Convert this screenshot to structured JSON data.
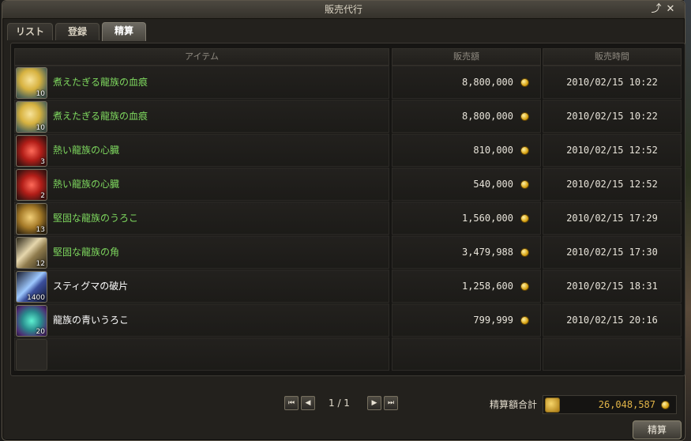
{
  "window": {
    "title": "販売代行"
  },
  "tabs": [
    {
      "label": "リスト"
    },
    {
      "label": "登録"
    },
    {
      "label": "精算"
    }
  ],
  "columns": {
    "item": "アイテム",
    "price": "販売額",
    "time": "販売時間"
  },
  "rows": [
    {
      "name": "煮えたぎる龍族の血痕",
      "count": "10",
      "price": "8,800,000",
      "time": "2010/02/15 10:22",
      "icon": "golden-blood-splatter-icon"
    },
    {
      "name": "煮えたぎる龍族の血痕",
      "count": "10",
      "price": "8,800,000",
      "time": "2010/02/15 10:22",
      "icon": "golden-blood-splatter-icon"
    },
    {
      "name": "熱い龍族の心臓",
      "count": "3",
      "price": "810,000",
      "time": "2010/02/15 12:52",
      "icon": "red-heart-icon"
    },
    {
      "name": "熱い龍族の心臓",
      "count": "2",
      "price": "540,000",
      "time": "2010/02/15 12:52",
      "icon": "red-heart-icon"
    },
    {
      "name": "堅固な龍族のうろこ",
      "count": "13",
      "price": "1,560,000",
      "time": "2010/02/15 17:29",
      "icon": "golden-scale-icon"
    },
    {
      "name": "堅固な龍族の角",
      "count": "12",
      "price": "3,479,988",
      "time": "2010/02/15 17:30",
      "icon": "horn-icon"
    },
    {
      "name": "スティグマの破片",
      "count": "1400",
      "price": "1,258,600",
      "time": "2010/02/15 18:31",
      "icon": "stigma-shard-icon"
    },
    {
      "name": "龍族の青いうろこ",
      "count": "20",
      "price": "799,999",
      "time": "2010/02/15 20:16",
      "icon": "blue-scale-icon"
    }
  ],
  "pager": {
    "page": "1 / 1"
  },
  "total": {
    "label": "精算額合計",
    "value": "26,048,587"
  },
  "settle_button": "精算",
  "colors": {
    "material_name": "#7ed85f",
    "normal_name": "#ffffff",
    "gold": "#e2b548"
  }
}
